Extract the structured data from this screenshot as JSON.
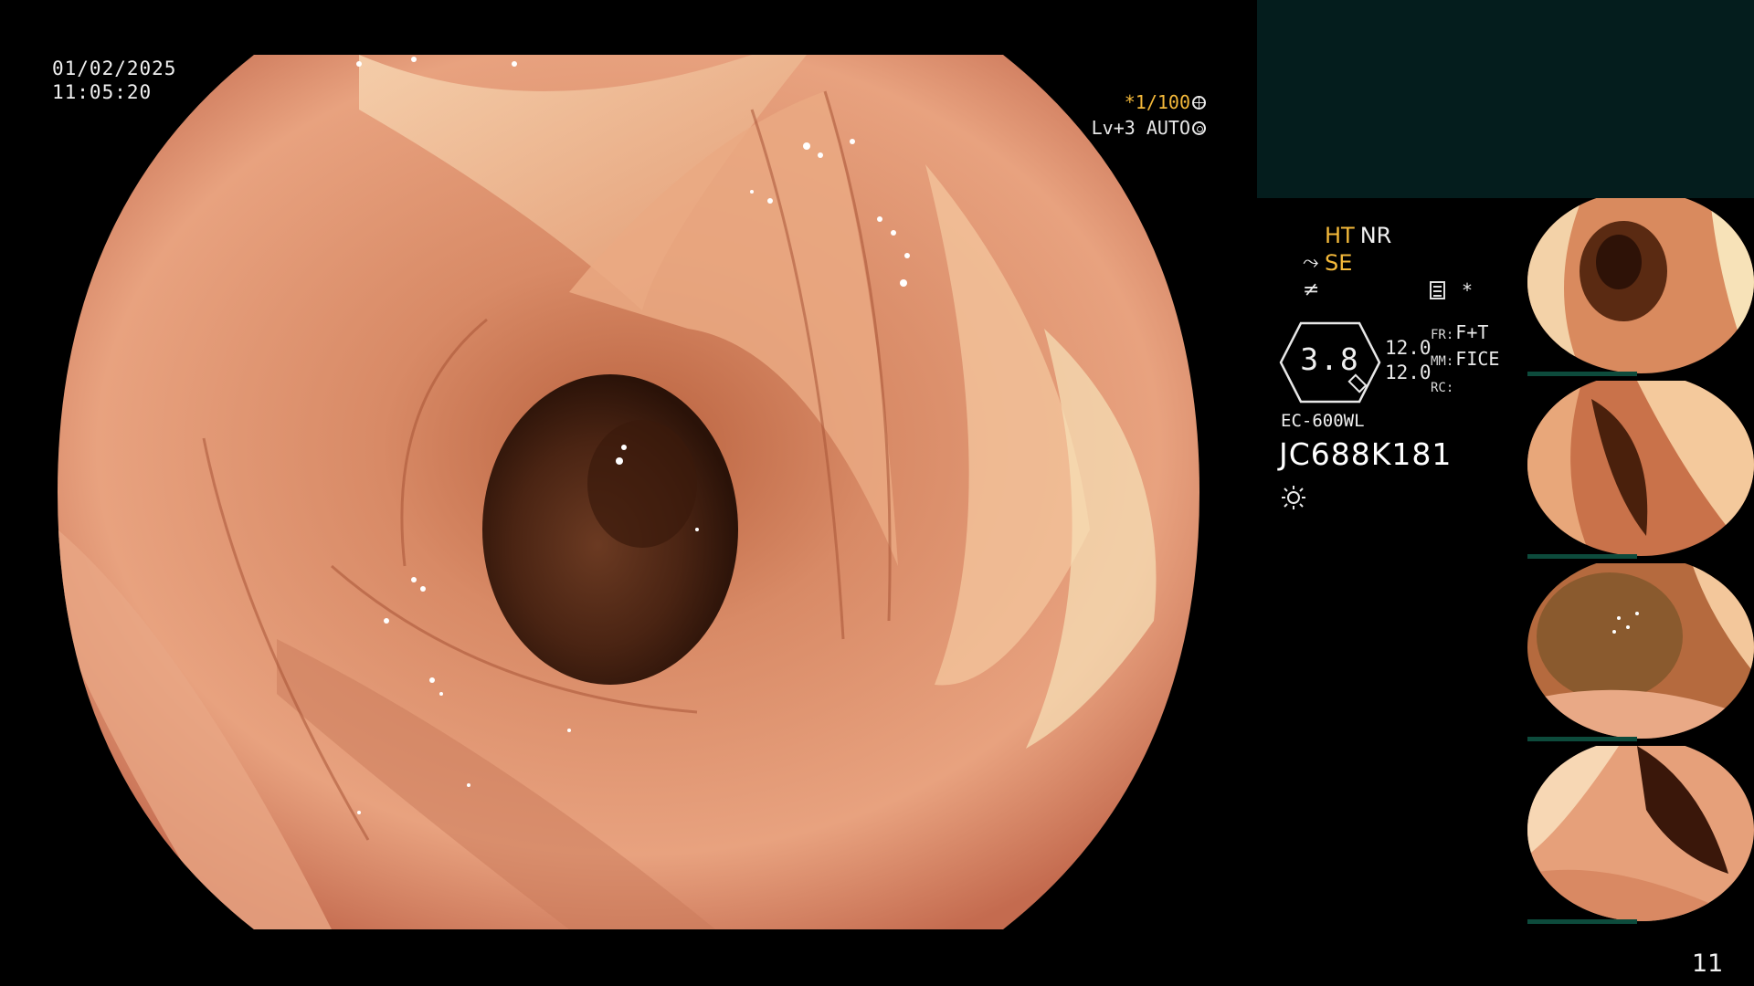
{
  "datetime": {
    "date": "01/02/2025",
    "time": "11:05:20"
  },
  "status": {
    "shutter": "*1/100",
    "level": "Lv+3 AUTO"
  },
  "mode": {
    "ht": "HT",
    "nr": "NR",
    "se": "SE"
  },
  "zoom": {
    "value": "3.8"
  },
  "levels": {
    "a": "12.0",
    "b": "12.0"
  },
  "codes": {
    "fr_key": "FR:",
    "fr_val": "F+T",
    "mm_key": "MM:",
    "mm_val": "FICE",
    "rc_key": "RC:"
  },
  "scope": {
    "model": "EC-600WL",
    "serial": "JC688K181"
  },
  "asterisk": "*",
  "page_number": "11",
  "colors": {
    "accent_yellow": "#f4b93a",
    "panel_dark": "#041d1d",
    "thumb_bar": "#0d4b3c"
  },
  "icons": [
    "shutter-wheel-icon",
    "gear-icon",
    "scissor-icon",
    "freeze-icon",
    "record-icon",
    "brightness-icon"
  ]
}
